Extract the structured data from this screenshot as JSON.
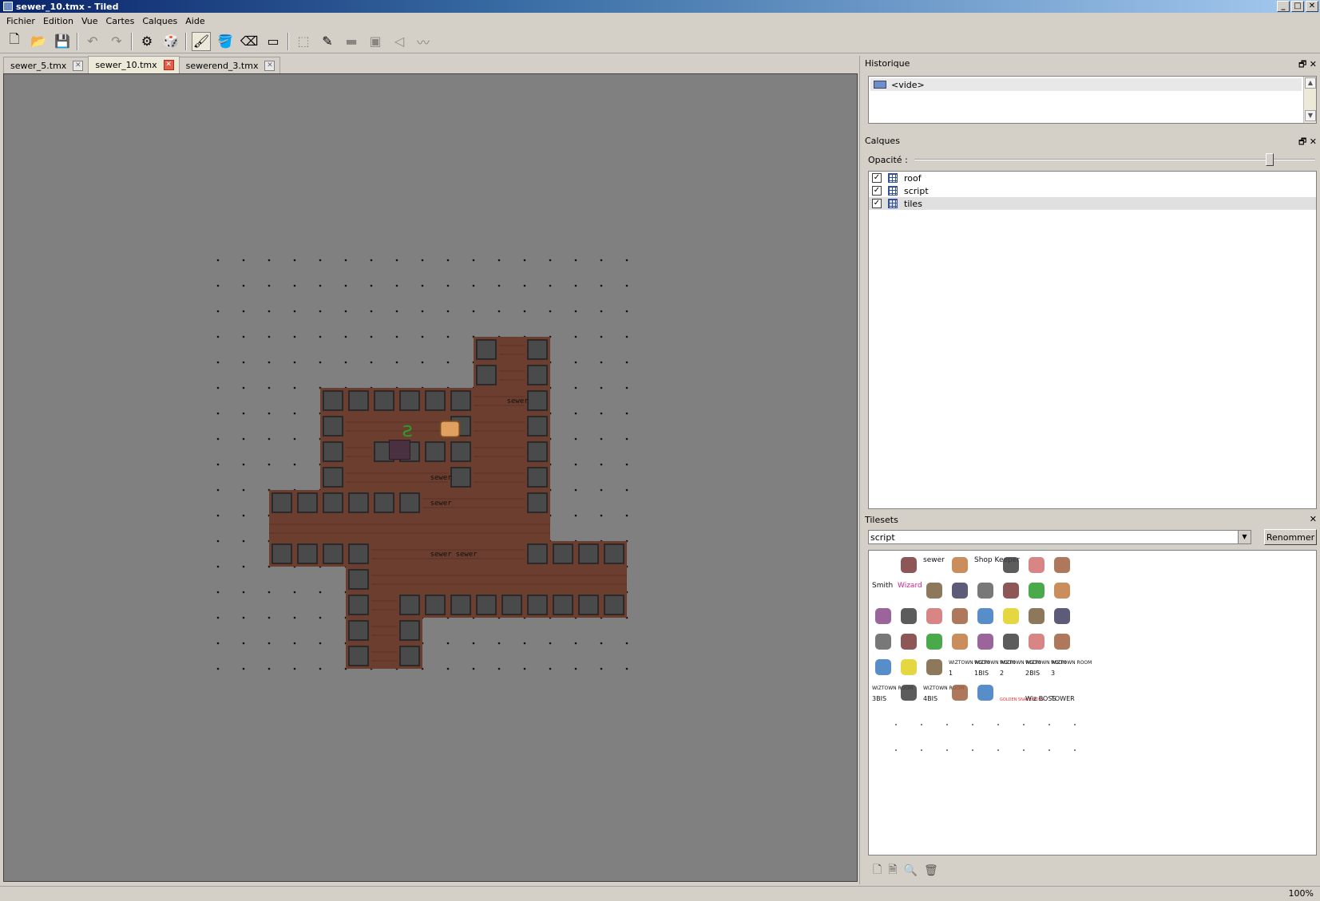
{
  "window": {
    "title": "sewer_10.tmx - Tiled"
  },
  "menu": [
    "Fichier",
    "Edition",
    "Vue",
    "Cartes",
    "Calques",
    "Aide"
  ],
  "tabs": [
    {
      "label": "sewer_5.tmx",
      "active": false
    },
    {
      "label": "sewer_10.tmx",
      "active": true
    },
    {
      "label": "sewerend_3.tmx",
      "active": false
    }
  ],
  "history": {
    "title": "Historique",
    "items": [
      "<vide>"
    ]
  },
  "layers": {
    "title": "Calques",
    "opacity_label": "Opacité :",
    "opacity_value": 0.92,
    "items": [
      {
        "name": "roof",
        "visible": true,
        "selected": false
      },
      {
        "name": "script",
        "visible": true,
        "selected": false
      },
      {
        "name": "tiles",
        "visible": true,
        "selected": true
      }
    ]
  },
  "tilesets": {
    "title": "Tilesets",
    "selected": "script",
    "rename_label": "Renommer"
  },
  "map": {
    "cols": 16,
    "rows": 16,
    "labels": [
      "sewer",
      "sewer",
      "sewer",
      "sewer",
      "sewer"
    ]
  },
  "status": {
    "zoom": "100%"
  },
  "tileset_texts": [
    "sewer",
    "Shop Keeper",
    "Smith",
    "Wizard",
    "WIZTOWN ROOM",
    "1",
    "1BIS",
    "2",
    "2BIS",
    "3",
    "3BIS",
    "4BIS",
    "GOLDEN SNAKE BOSS",
    "Wiz BOSS",
    "TOWER"
  ]
}
